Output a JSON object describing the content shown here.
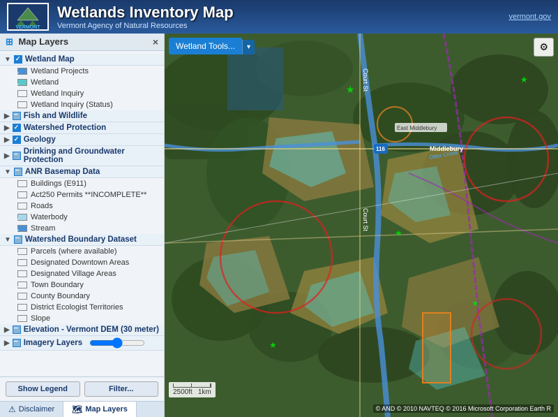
{
  "header": {
    "logo_text": "VERMONT",
    "main_title": "Wetlands Inventory Map",
    "sub_title": "Vermont Agency of Natural Resources",
    "gov_link": "vermont.gov"
  },
  "sidebar": {
    "title": "Map Layers",
    "collapse_icon": "×",
    "groups": [
      {
        "id": "wetland-map",
        "label": "Wetland Map",
        "expanded": true,
        "check_state": "checked",
        "items": [
          {
            "label": "Wetland Projects",
            "checked": true,
            "swatch": "blue"
          },
          {
            "label": "Wetland",
            "checked": true,
            "swatch": "teal"
          },
          {
            "label": "Wetland Inquiry",
            "checked": false,
            "swatch": "none"
          },
          {
            "label": "Wetland Inquiry (Status)",
            "checked": false,
            "swatch": "none"
          }
        ]
      },
      {
        "id": "fish-wildlife",
        "label": "Fish and Wildlife",
        "expanded": false,
        "check_state": "partial",
        "items": []
      },
      {
        "id": "watershed-protection",
        "label": "Watershed Protection",
        "expanded": false,
        "check_state": "checked",
        "items": []
      },
      {
        "id": "geology",
        "label": "Geology",
        "expanded": false,
        "check_state": "checked",
        "items": []
      },
      {
        "id": "drinking-water",
        "label": "Drinking and Groundwater Protection",
        "expanded": false,
        "check_state": "partial",
        "items": []
      },
      {
        "id": "anr-basemap",
        "label": "ANR Basemap Data",
        "expanded": true,
        "check_state": "partial",
        "items": [
          {
            "label": "Buildings (E911)",
            "checked": false,
            "swatch": "none"
          },
          {
            "label": "Act250 Permits **INCOMPLETE**",
            "checked": false,
            "swatch": "none"
          },
          {
            "label": "Roads",
            "checked": false,
            "swatch": "none"
          },
          {
            "label": "Waterbody",
            "checked": true,
            "swatch": "lt-blue"
          },
          {
            "label": "Stream",
            "checked": true,
            "swatch": "blue"
          }
        ]
      },
      {
        "id": "watershed-boundary",
        "label": "Watershed Boundary Dataset",
        "expanded": true,
        "check_state": "partial",
        "items": [
          {
            "label": "Parcels (where available)",
            "checked": true,
            "swatch": "none"
          },
          {
            "label": "Designated Downtown Areas",
            "checked": false,
            "swatch": "none"
          },
          {
            "label": "Designated Village Areas",
            "checked": false,
            "swatch": "none"
          },
          {
            "label": "Town Boundary",
            "checked": true,
            "swatch": "none"
          },
          {
            "label": "County Boundary",
            "checked": false,
            "swatch": "none"
          },
          {
            "label": "District Ecologist Territories",
            "checked": false,
            "swatch": "none"
          },
          {
            "label": "Slope",
            "checked": false,
            "swatch": "none"
          }
        ]
      },
      {
        "id": "elevation",
        "label": "Elevation - Vermont DEM (30 meter)",
        "expanded": false,
        "check_state": "partial",
        "items": []
      },
      {
        "id": "imagery",
        "label": "Imagery Layers",
        "expanded": false,
        "check_state": "partial",
        "items": []
      }
    ],
    "show_legend_label": "Show Legend",
    "filter_label": "Filter...",
    "tabs": [
      {
        "id": "disclaimer",
        "label": "Disclaimer",
        "icon": "⚠"
      },
      {
        "id": "map-layers",
        "label": "Map Layers",
        "icon": "🗺",
        "active": true
      }
    ]
  },
  "map": {
    "toolbar_label": "Wetland Tools...",
    "toolbar_dropdown": "▾",
    "tools_icon": "⚙",
    "scale": {
      "distance1": "2500ft",
      "distance2": "1km"
    },
    "attribution": "© AND © 2010 NAVTEQ © 2016 Microsoft Corporation Earth R"
  }
}
